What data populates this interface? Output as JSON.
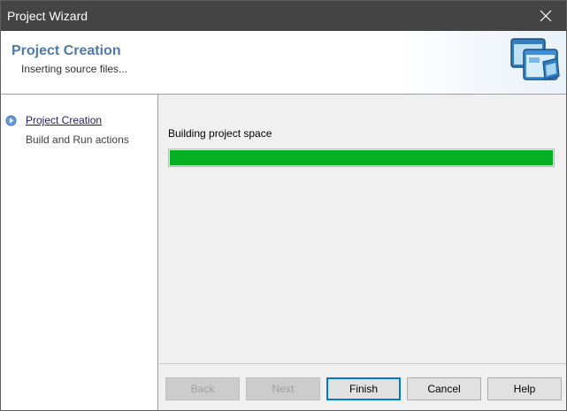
{
  "window": {
    "title": "Project Wizard"
  },
  "header": {
    "title": "Project Creation",
    "subtitle": "Inserting source files..."
  },
  "steps": [
    {
      "label": "Project Creation",
      "active": true
    },
    {
      "label": "Build and Run actions",
      "active": false
    }
  ],
  "progress": {
    "label": "Building project space",
    "value_percent": 100,
    "color": "#06b025"
  },
  "buttons": {
    "back": "Back",
    "next": "Next",
    "finish": "Finish",
    "cancel": "Cancel",
    "help": "Help"
  },
  "colors": {
    "titlebar": "#444444",
    "header_title": "#4f7aa7",
    "default_button_border": "#0078d7"
  }
}
